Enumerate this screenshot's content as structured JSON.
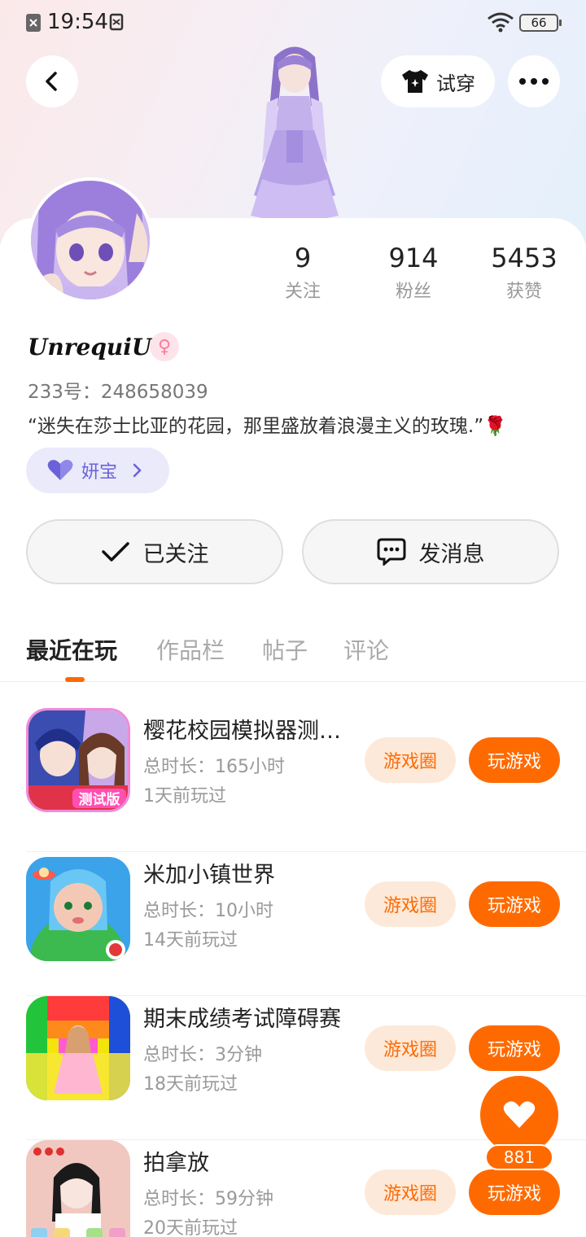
{
  "status_bar": {
    "time": "19:54",
    "battery": "66"
  },
  "header": {
    "tryon_label": "试穿"
  },
  "profile": {
    "stats": [
      {
        "value": "9",
        "label": "关注"
      },
      {
        "value": "914",
        "label": "粉丝"
      },
      {
        "value": "5453",
        "label": "获赞"
      }
    ],
    "username": "UnrequiU",
    "gender_symbol": "♀",
    "uid": "233号：248658039",
    "bio": "“迷失在莎士比亚的花园，那里盛放着浪漫主义的玫瑰.”🌹",
    "pet_label": "妍宝",
    "follow_label": "已关注",
    "message_label": "发消息"
  },
  "tabs": [
    "最近在玩",
    "作品栏",
    "帖子",
    "评论"
  ],
  "games": [
    {
      "title": "樱花校园模拟器测试版",
      "duration": "总时长：165小时",
      "last_played": "1天前玩过",
      "circle_label": "游戏圈",
      "play_label": "玩游戏"
    },
    {
      "title": "米加小镇世界",
      "duration": "总时长：10小时",
      "last_played": "14天前玩过",
      "circle_label": "游戏圈",
      "play_label": "玩游戏"
    },
    {
      "title": "期末成绩考试障碍赛",
      "duration": "总时长：3分钟",
      "last_played": "18天前玩过",
      "circle_label": "游戏圈",
      "play_label": "玩游戏"
    },
    {
      "title": "拍拿放",
      "duration": "总时长：59分钟",
      "last_played": "20天前玩过",
      "circle_label": "游戏圈",
      "play_label": "玩游戏"
    }
  ],
  "game_icon_texts": {
    "sakura_badge": "测试版"
  },
  "like_count": "881",
  "colors": {
    "accent": "#ff6a00",
    "accent_light": "#fde9d9",
    "pet_chip": "#ebeafb",
    "pet_text": "#6b62d9"
  }
}
